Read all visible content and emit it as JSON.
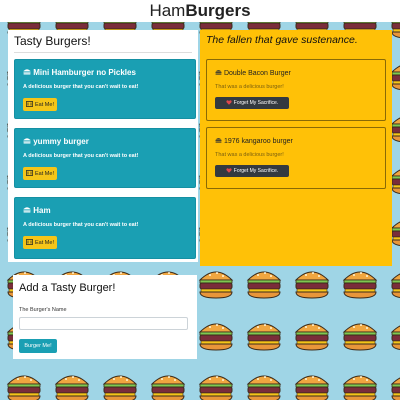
{
  "header": {
    "title_part1": "Ham",
    "title_part2": "Burgers"
  },
  "tasty": {
    "title": "Tasty Burgers!",
    "cards": [
      {
        "name": "Mini Hamburger no Pickles",
        "text": "A delicious burger that you can't wait to eat!",
        "button": "Eat Me!"
      },
      {
        "name": "yummy burger",
        "text": "A delicious burger that you can't wait to eat!",
        "button": "Eat Me!"
      },
      {
        "name": "Ham",
        "text": "A delicious burger that you can't wait to eat!",
        "button": "Eat Me!"
      }
    ]
  },
  "devoured": {
    "title": "The fallen that gave sustenance.",
    "cards": [
      {
        "name": "Double Bacon Burger",
        "text": "That was a delicious burger!",
        "button": "Forget My Sacrifice."
      },
      {
        "name": "1976 kangaroo burger",
        "text": "That was a delicious burger!",
        "button": "Forget My Sacrifice."
      }
    ]
  },
  "add_form": {
    "title": "Add a Tasty Burger!",
    "label": "The Burger's Name",
    "placeholder": "",
    "button": "Burger Me!"
  },
  "colors": {
    "teal": "#1a9fb3",
    "yellow": "#ffc107",
    "dark_button": "#343a40",
    "background": "#9fd5e6"
  },
  "icons": [
    "burger-icon",
    "utensils-icon",
    "heart-icon"
  ]
}
